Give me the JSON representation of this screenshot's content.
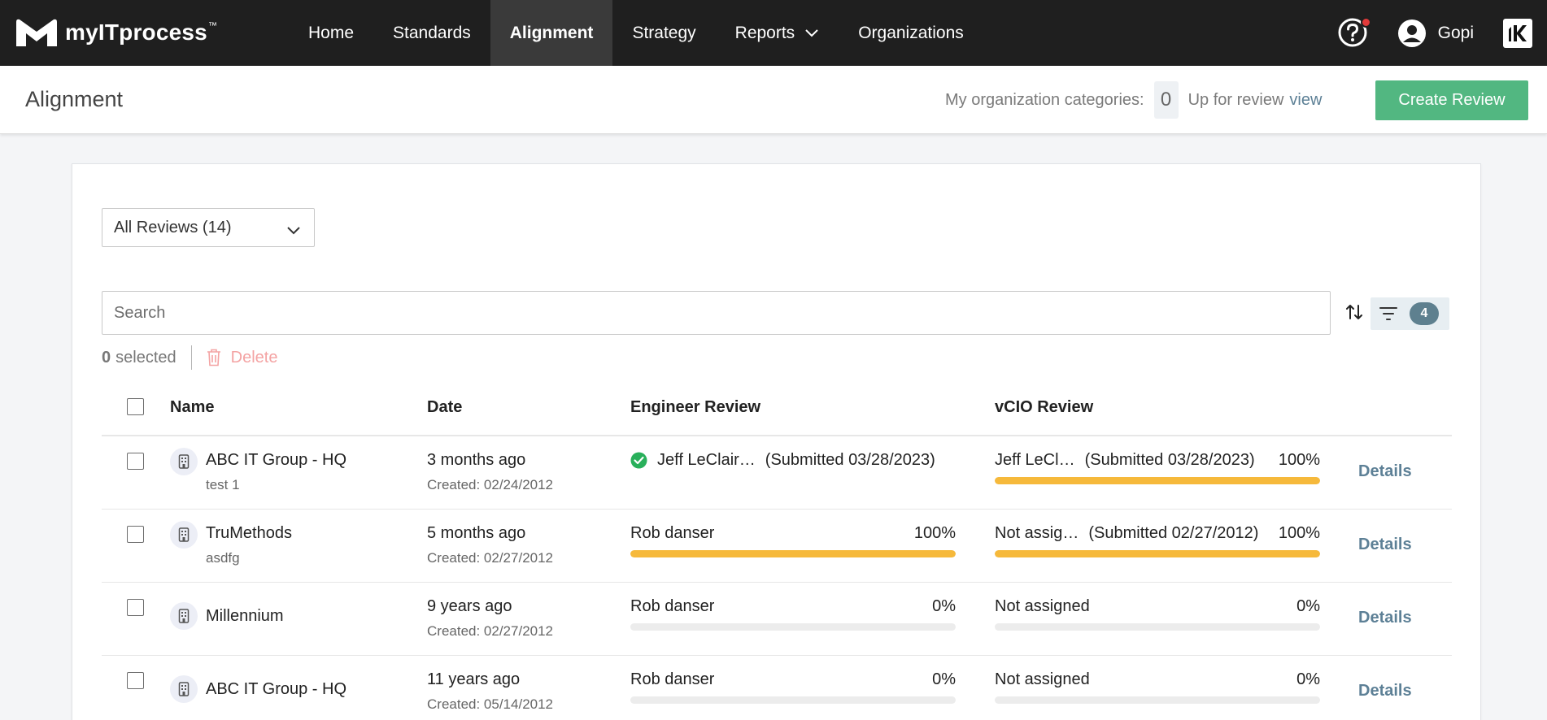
{
  "colors": {
    "nav_bg": "#1f1f1f",
    "accent_green": "#52b781",
    "progress": "#f6b93b",
    "link": "#5d8096",
    "notification": "#e23b3b",
    "delete": "#f4a3a3"
  },
  "brand": {
    "name": "myITprocess",
    "tm": "™"
  },
  "nav": {
    "items": [
      {
        "label": "Home"
      },
      {
        "label": "Standards"
      },
      {
        "label": "Alignment"
      },
      {
        "label": "Strategy"
      },
      {
        "label": "Reports"
      },
      {
        "label": "Organizations"
      }
    ],
    "user_name": "Gopi"
  },
  "header": {
    "title": "Alignment",
    "org_categories_label": "My organization categories:",
    "org_categories_count": "0",
    "up_for_review_label": "Up for review",
    "view_link": "view",
    "create_button": "Create Review"
  },
  "toolbar": {
    "filter_select": "All Reviews (14)",
    "search_placeholder": "Search",
    "filter_count": "4",
    "selected_count": "0",
    "selected_label": "selected",
    "delete_label": "Delete"
  },
  "table": {
    "columns": {
      "name": "Name",
      "date": "Date",
      "engineer": "Engineer Review",
      "vcio": "vCIO Review"
    },
    "details_label": "Details",
    "rows": [
      {
        "name": "ABC IT Group - HQ",
        "sub": "test 1",
        "date": "3 months ago",
        "created": "Created: 02/24/2012",
        "engineer": {
          "reviewer": "Jeff LeClair…",
          "status": "(Submitted 03/28/2023)",
          "pct": "",
          "progress": 0,
          "completed": true
        },
        "vcio": {
          "reviewer": "Jeff LeCl…",
          "status": "(Submitted 03/28/2023)",
          "pct": "100%",
          "progress": 100
        }
      },
      {
        "name": "TruMethods",
        "sub": "asdfg",
        "date": "5 months ago",
        "created": "Created: 02/27/2012",
        "engineer": {
          "reviewer": "Rob danser",
          "status": "",
          "pct": "100%",
          "progress": 100,
          "completed": false
        },
        "vcio": {
          "reviewer": "Not assig…",
          "status": "(Submitted 02/27/2012)",
          "pct": "100%",
          "progress": 100
        }
      },
      {
        "name": "Millennium",
        "sub": "",
        "date": "9 years ago",
        "created": "Created: 02/27/2012",
        "engineer": {
          "reviewer": "Rob danser",
          "status": "",
          "pct": "0%",
          "progress": 0,
          "completed": false
        },
        "vcio": {
          "reviewer": "Not assigned",
          "status": "",
          "pct": "0%",
          "progress": 0
        }
      },
      {
        "name": "ABC IT Group - HQ",
        "sub": "",
        "date": "11 years ago",
        "created": "Created: 05/14/2012",
        "engineer": {
          "reviewer": "Rob danser",
          "status": "",
          "pct": "0%",
          "progress": 0,
          "completed": false
        },
        "vcio": {
          "reviewer": "Not assigned",
          "status": "",
          "pct": "0%",
          "progress": 0
        }
      }
    ]
  }
}
